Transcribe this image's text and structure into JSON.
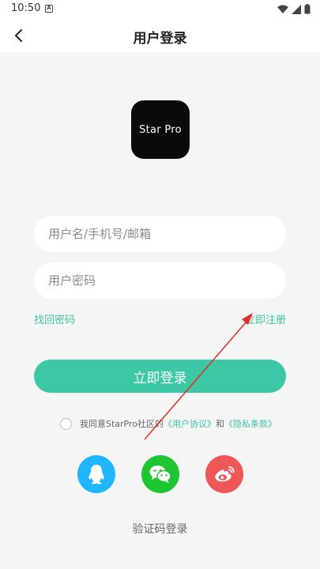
{
  "status": {
    "time": "10:50",
    "indicator": "A"
  },
  "header": {
    "title": "用户登录",
    "back_icon": "chevron-left-icon"
  },
  "logo": {
    "text": "Star Pro"
  },
  "form": {
    "username_placeholder": "用户名/手机号/邮箱",
    "password_placeholder": "用户密码",
    "forgot_label": "找回密码",
    "register_label": "立即注册",
    "login_label": "立即登录"
  },
  "agreement": {
    "prefix": "我同意StarPro社区的",
    "user_agreement": "《用户协议》",
    "and": "和",
    "privacy": "《隐私条款》"
  },
  "social": [
    "qq-icon",
    "wechat-icon",
    "weibo-icon"
  ],
  "footer": {
    "code_login": "验证码登录"
  },
  "colors": {
    "accent": "#3cc8a4",
    "qq": "#1fb6ff",
    "wechat": "#1dc630",
    "weibo": "#ef5656",
    "annotation": "#e0302a"
  }
}
